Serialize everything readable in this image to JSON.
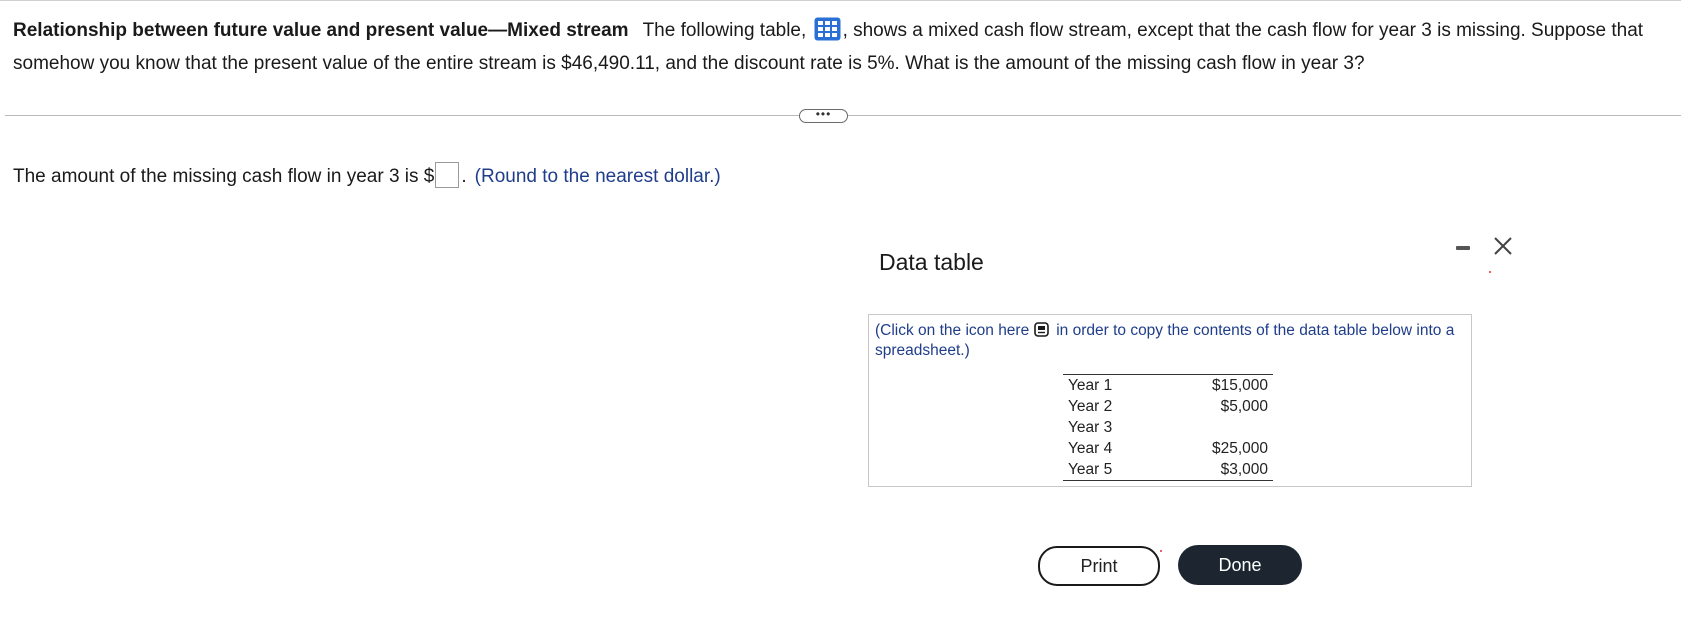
{
  "question": {
    "title": "Relationship between future value and present value—Mixed stream",
    "text_before_icon": "The following table,",
    "table_icon": "table-grid-icon",
    "text_after_icon": ", shows a mixed cash flow stream, except that the cash flow for year 3 is missing.  Suppose that somehow you know that the present value of the entire stream is $46,490.11, and the discount rate is 5%.  What is the amount of the missing cash flow in year 3?"
  },
  "more_button": {
    "label": "•••"
  },
  "answer": {
    "prefix": "The amount of the missing cash flow in year 3 is $",
    "value": "",
    "suffix": ".",
    "hint": "(Round to the nearest dollar.)"
  },
  "dialog": {
    "title": "Data table",
    "minimize_icon": "minimize-icon",
    "close_icon": "close-icon",
    "note_before": "(Click on the icon here",
    "copy_icon": "copy-icon",
    "note_after": "in order to copy the contents of the data table below into a spreadsheet.)",
    "rows": [
      {
        "label": "Year 1",
        "value": "$15,000"
      },
      {
        "label": "Year 2",
        "value": "$5,000"
      },
      {
        "label": "Year 3",
        "value": ""
      },
      {
        "label": "Year 4",
        "value": "$25,000"
      },
      {
        "label": "Year 5",
        "value": "$3,000"
      }
    ],
    "print_label": "Print",
    "done_label": "Done"
  },
  "colors": {
    "hint_blue": "#1f3d8a",
    "icon_blue": "#2a6fd6",
    "done_bg": "#1d2630"
  }
}
